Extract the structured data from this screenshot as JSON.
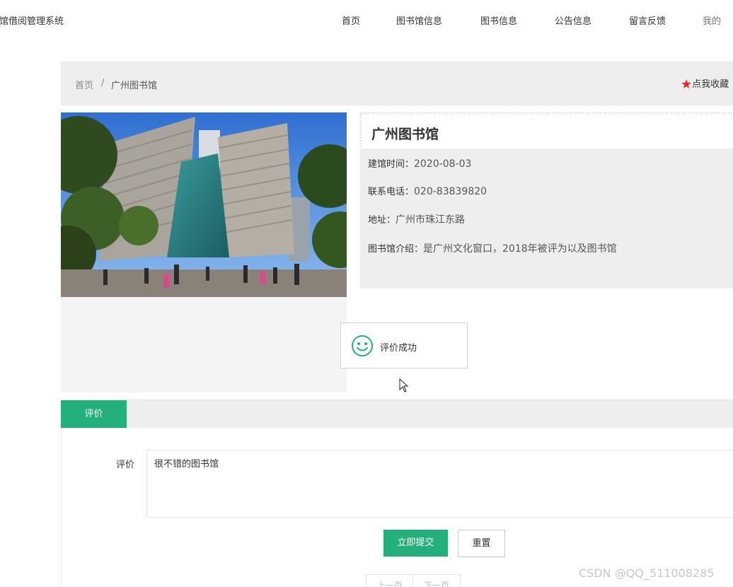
{
  "header": {
    "site_title": "书馆借阅管理系统",
    "nav": [
      "首页",
      "图书馆信息",
      "图书信息",
      "公告信息",
      "留言反馈",
      "我的"
    ]
  },
  "breadcrumb": {
    "home": "首页",
    "separator": "/",
    "current": "广州图书馆"
  },
  "favorite": {
    "label": "点我收藏"
  },
  "library": {
    "name": "广州图书馆",
    "fields": [
      {
        "label": "建馆时间：",
        "value": "2020-08-03"
      },
      {
        "label": "联系电话：",
        "value": "020-83839820"
      },
      {
        "label": "地址：",
        "value": "广州市珠江东路"
      },
      {
        "label": "图书馆介绍：",
        "value": "是广州文化窗口，2018年被评为以及图书馆"
      }
    ]
  },
  "toast": {
    "message": "评价成功"
  },
  "tabs": {
    "active": "评价"
  },
  "form": {
    "label": "评价",
    "value": "很不错的图书馆",
    "submit": "立即提交",
    "reset": "重置"
  },
  "pager": {
    "prev": "上一页",
    "next": "下一页"
  },
  "watermark": "CSDN @QQ_511008285",
  "colors": {
    "accent": "#24b07c",
    "star": "#ff1f1f"
  }
}
